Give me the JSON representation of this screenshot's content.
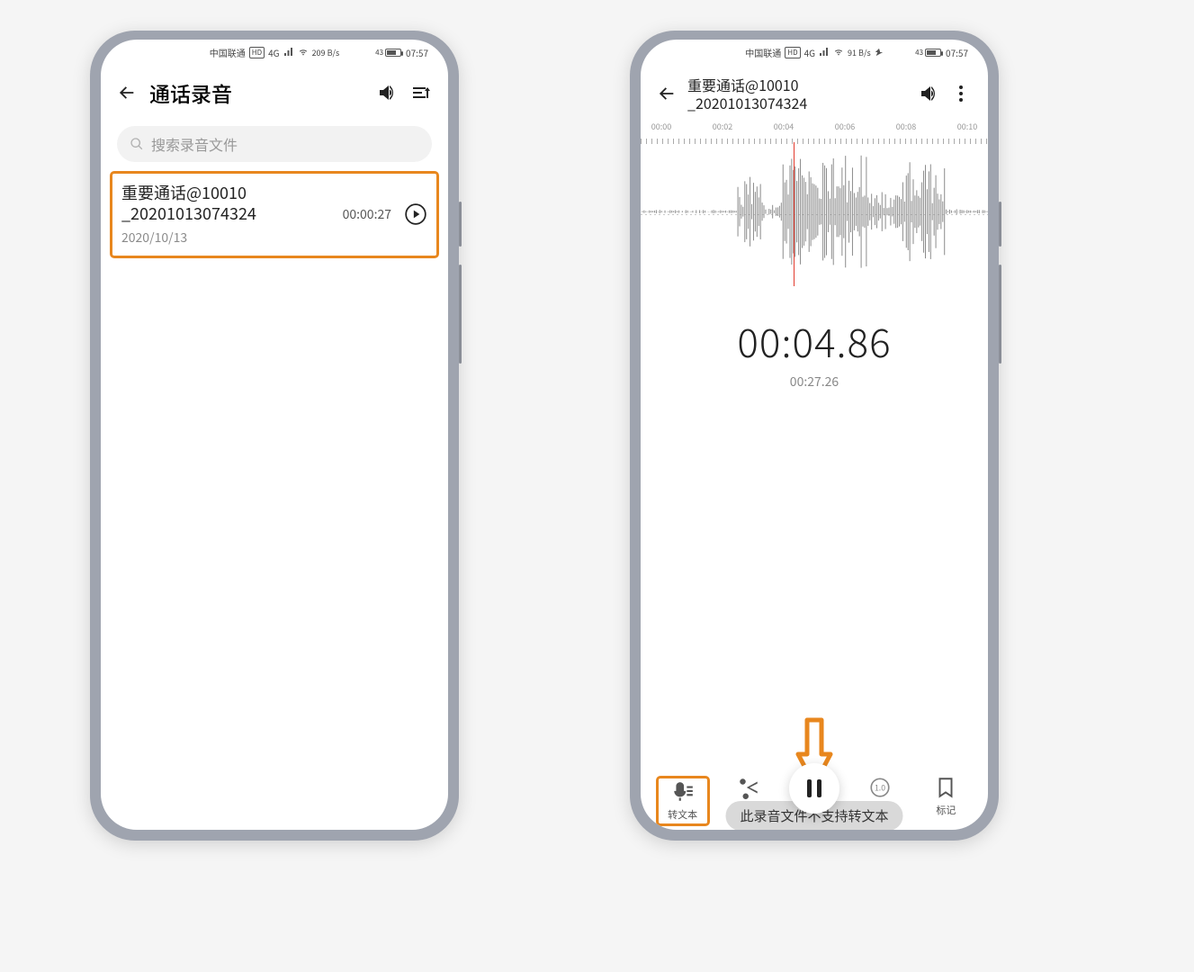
{
  "status": {
    "carrier": "中国联通",
    "hd": "HD",
    "net": "4G",
    "speedA": "209 B/s",
    "speedB": "91 B/s",
    "battA": "43",
    "battB": "43",
    "time": "07:57"
  },
  "phoneA": {
    "title": "通话录音",
    "search_placeholder": "搜索录音文件",
    "file": {
      "name1": "重要通话@10010",
      "name2": "_20201013074324",
      "date": "2020/10/13",
      "duration": "00:00:27"
    }
  },
  "phoneB": {
    "title1": "重要通话@10010",
    "title2": "_20201013074324",
    "ticks": [
      "00:00",
      "00:02",
      "00:04",
      "00:06",
      "00:08",
      "00:10"
    ],
    "elapsed": "00:04.86",
    "total": "00:27.26",
    "toast": "此录音文件不支持转文本",
    "tools": {
      "transcribe": "转文本",
      "trim": "",
      "skip": "",
      "speed": "",
      "mark": "标记"
    }
  },
  "colors": {
    "highlight": "#e8871e",
    "playhead": "#e23b2e"
  }
}
